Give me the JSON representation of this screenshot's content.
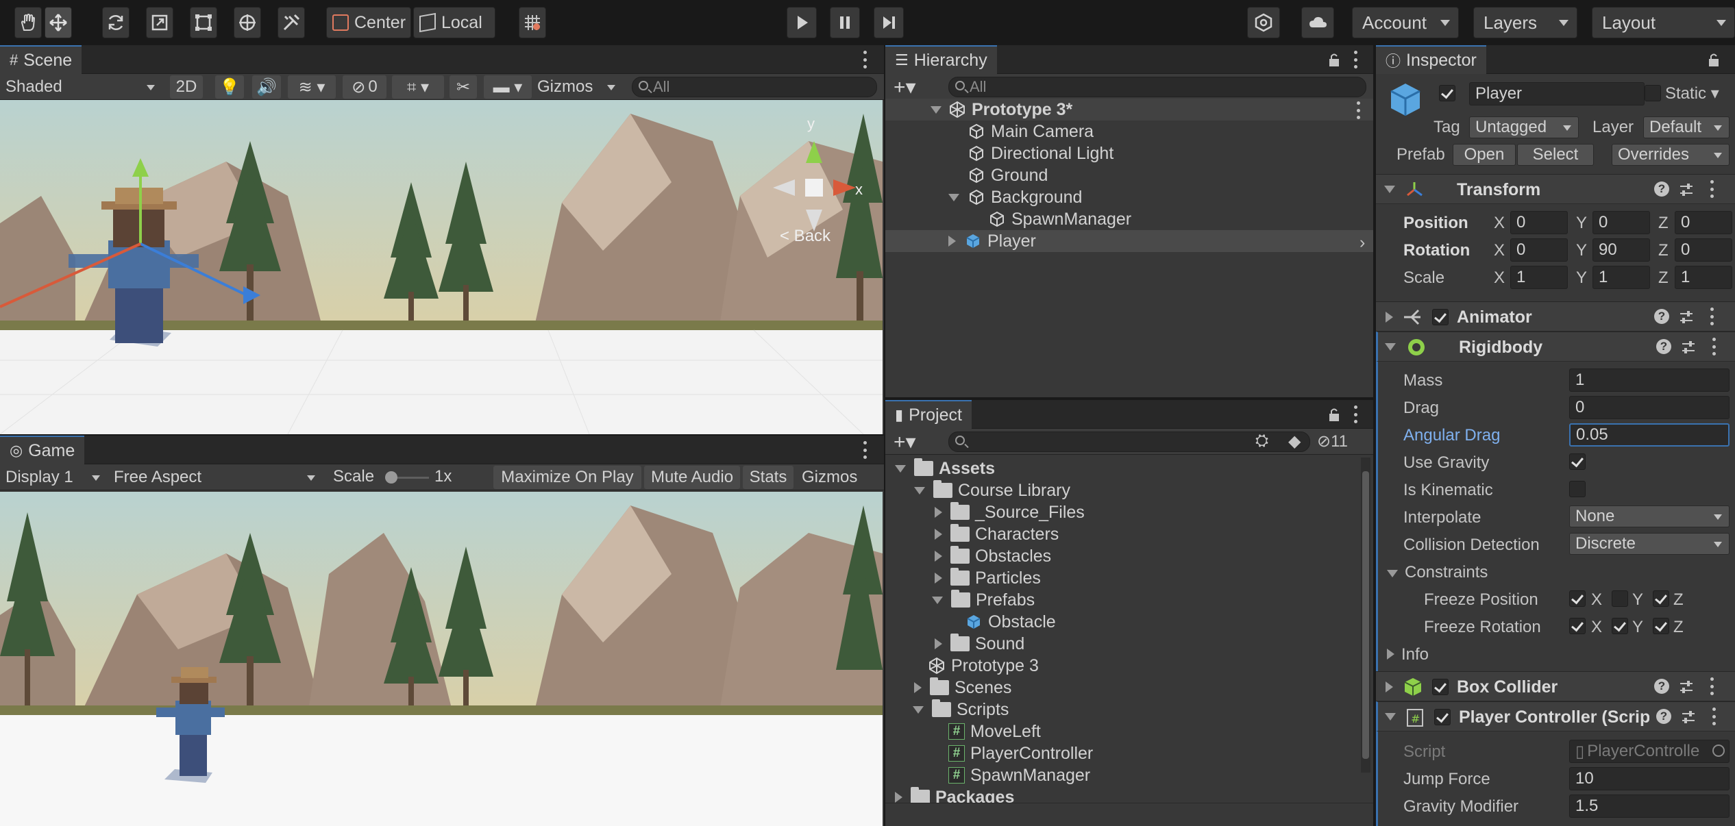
{
  "toolbar": {
    "pivot": "Center",
    "space": "Local",
    "account": "Account",
    "layers": "Layers",
    "layout": "Layout"
  },
  "scene": {
    "tab": "Scene",
    "shading": "Shaded",
    "mode_2d": "2D",
    "hidden_count": "0",
    "gizmos": "Gizmos",
    "search_placeholder": "All",
    "gizmo_y": "y",
    "gizmo_x": "x",
    "back_label": "< Back"
  },
  "game": {
    "tab": "Game",
    "display": "Display 1",
    "aspect": "Free Aspect",
    "scale_label": "Scale",
    "scale_value": "1x",
    "maximize": "Maximize On Play",
    "mute": "Mute Audio",
    "stats": "Stats",
    "gizmos": "Gizmos"
  },
  "hierarchy": {
    "tab": "Hierarchy",
    "search_placeholder": "All",
    "scene_name": "Prototype 3*",
    "items": [
      "Main Camera",
      "Directional Light",
      "Ground",
      "Background",
      "SpawnManager",
      "Player"
    ]
  },
  "project": {
    "tab": "Project",
    "hidden_count": "11",
    "items": [
      "Assets",
      "Course Library",
      "_Source_Files",
      "Characters",
      "Obstacles",
      "Particles",
      "Prefabs",
      "Obstacle",
      "Sound",
      "Prototype 3",
      "Scenes",
      "Scripts",
      "MoveLeft",
      "PlayerController",
      "SpawnManager",
      "Packages"
    ]
  },
  "inspector": {
    "tab": "Inspector",
    "object_name": "Player",
    "static_label": "Static",
    "tag_label": "Tag",
    "tag_value": "Untagged",
    "layer_label": "Layer",
    "layer_value": "Default",
    "prefab_label": "Prefab",
    "open": "Open",
    "select": "Select",
    "overrides": "Overrides",
    "transform": {
      "title": "Transform",
      "position_label": "Position",
      "rotation_label": "Rotation",
      "scale_label": "Scale",
      "axis_x": "X",
      "axis_y": "Y",
      "axis_z": "Z",
      "position": [
        "0",
        "0",
        "0"
      ],
      "rotation": [
        "0",
        "90",
        "0"
      ],
      "scale": [
        "1",
        "1",
        "1"
      ]
    },
    "animator": {
      "title": "Animator"
    },
    "rigidbody": {
      "title": "Rigidbody",
      "mass_label": "Mass",
      "mass": "1",
      "drag_label": "Drag",
      "drag": "0",
      "angular_drag_label": "Angular Drag",
      "angular_drag": "0.05",
      "use_gravity_label": "Use Gravity",
      "is_kinematic_label": "Is Kinematic",
      "interpolate_label": "Interpolate",
      "interpolate": "None",
      "collision_label": "Collision Detection",
      "collision": "Discrete",
      "constraints_label": "Constraints",
      "freeze_pos_label": "Freeze Position",
      "freeze_rot_label": "Freeze Rotation",
      "info_label": "Info"
    },
    "box_collider": {
      "title": "Box Collider"
    },
    "player_controller": {
      "title": "Player Controller (Scrip",
      "script_label": "Script",
      "script": "PlayerControlle",
      "jump_label": "Jump Force",
      "jump": "10",
      "gravity_label": "Gravity Modifier",
      "gravity": "1.5"
    }
  },
  "colors": {
    "accent": "#3a72b0",
    "panel": "#383838",
    "toolbar": "#191919"
  }
}
